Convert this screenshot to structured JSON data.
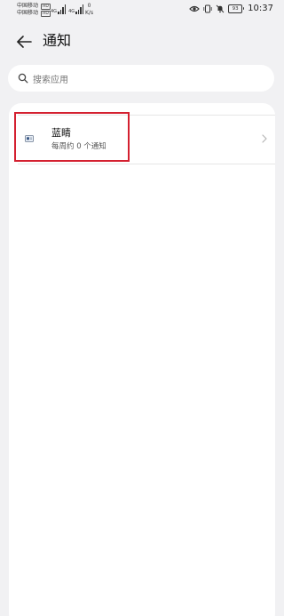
{
  "status_bar": {
    "carrier_1": "中国移动",
    "carrier_2": "中国移动",
    "hd_badge": "HD",
    "network_tag": "4G",
    "speed_value": "0",
    "speed_unit": "K/s",
    "battery": "93",
    "time": "10:37"
  },
  "header": {
    "title": "通知"
  },
  "search": {
    "placeholder": "搜索应用"
  },
  "apps": [
    {
      "name": "蓝睛",
      "subtitle": "每周约 0 个通知"
    }
  ],
  "colors": {
    "background": "#f1f1f3",
    "card": "#ffffff",
    "highlight": "#d42030"
  }
}
